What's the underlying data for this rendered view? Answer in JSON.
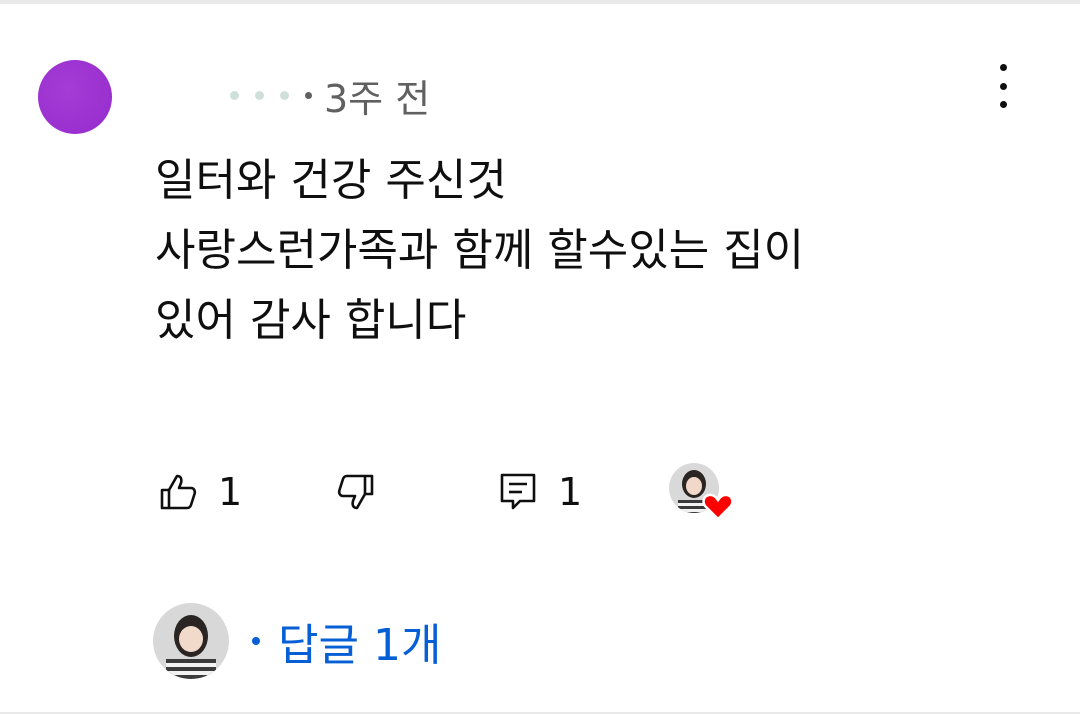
{
  "comment": {
    "author_avatar_color": "#9b32d0",
    "time_ago": "3주 전",
    "lines": [
      "일터와 건강 주신것",
      "사랑스런가족과 함께 할수있는 집이",
      "있어 감사 합니다"
    ],
    "like_count": "1",
    "reply_count_badge": "1"
  },
  "replies": {
    "label": "답글 1개",
    "color": "#065fd4"
  },
  "icons": {
    "more": "more-vertical-icon",
    "like": "thumbs-up-icon",
    "dislike": "thumbs-down-icon",
    "reply": "comment-icon",
    "heart": "heart-icon"
  }
}
